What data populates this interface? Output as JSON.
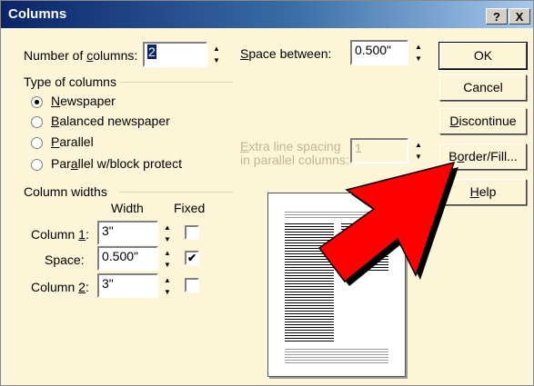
{
  "title": "Columns",
  "title_buttons": {
    "help": "?",
    "close": "X"
  },
  "num_columns": {
    "label_pre": "Number of ",
    "label_u": "c",
    "label_post": "olumns:",
    "value": "2"
  },
  "space_between": {
    "label_u": "S",
    "label_post": "pace between:",
    "value": "0.500\""
  },
  "type_group": {
    "title": "Type of columns"
  },
  "types": [
    {
      "u": "N",
      "rest": "ewspaper",
      "selected": true
    },
    {
      "u": "B",
      "rest": "alanced newspaper",
      "selected": false
    },
    {
      "u": "P",
      "rest": "arallel",
      "selected": false
    },
    {
      "pre": "Par",
      "u": "a",
      "rest": "llel w/block protect",
      "selected": false
    }
  ],
  "extra_spacing": {
    "line1_u": "E",
    "line1_rest": "xtra line spacing",
    "line2": "in parallel columns:",
    "value": "1"
  },
  "widths": {
    "title": "Column widths",
    "width_header": "Width",
    "fixed_header": "Fixed",
    "rows": [
      {
        "pre": "Column ",
        "u": "1",
        "post": ":",
        "value": "3\"",
        "fixed": false
      },
      {
        "pre": "Space:",
        "u": "",
        "post": "",
        "value": "0.500\"",
        "fixed": true
      },
      {
        "pre": "Column ",
        "u": "2",
        "post": ":",
        "value": "3\"",
        "fixed": false
      }
    ]
  },
  "buttons": {
    "ok": "OK",
    "cancel": "Cancel",
    "discontinue_u": "D",
    "discontinue_rest": "iscontinue",
    "border_pre": "B",
    "border_u": "o",
    "border_rest": "rder/Fill...",
    "help_u": "H",
    "help_rest": "elp"
  },
  "colors": {
    "title_start": "#0a246a",
    "title_end": "#a6caf0",
    "dialog_bg": "#fdf5d8",
    "arrow": "#ff0000"
  },
  "icons": {
    "spin_up": "spin-up-arrow",
    "spin_down": "spin-down-arrow",
    "check": "check-mark",
    "callout": "red-arrow-pointer"
  }
}
